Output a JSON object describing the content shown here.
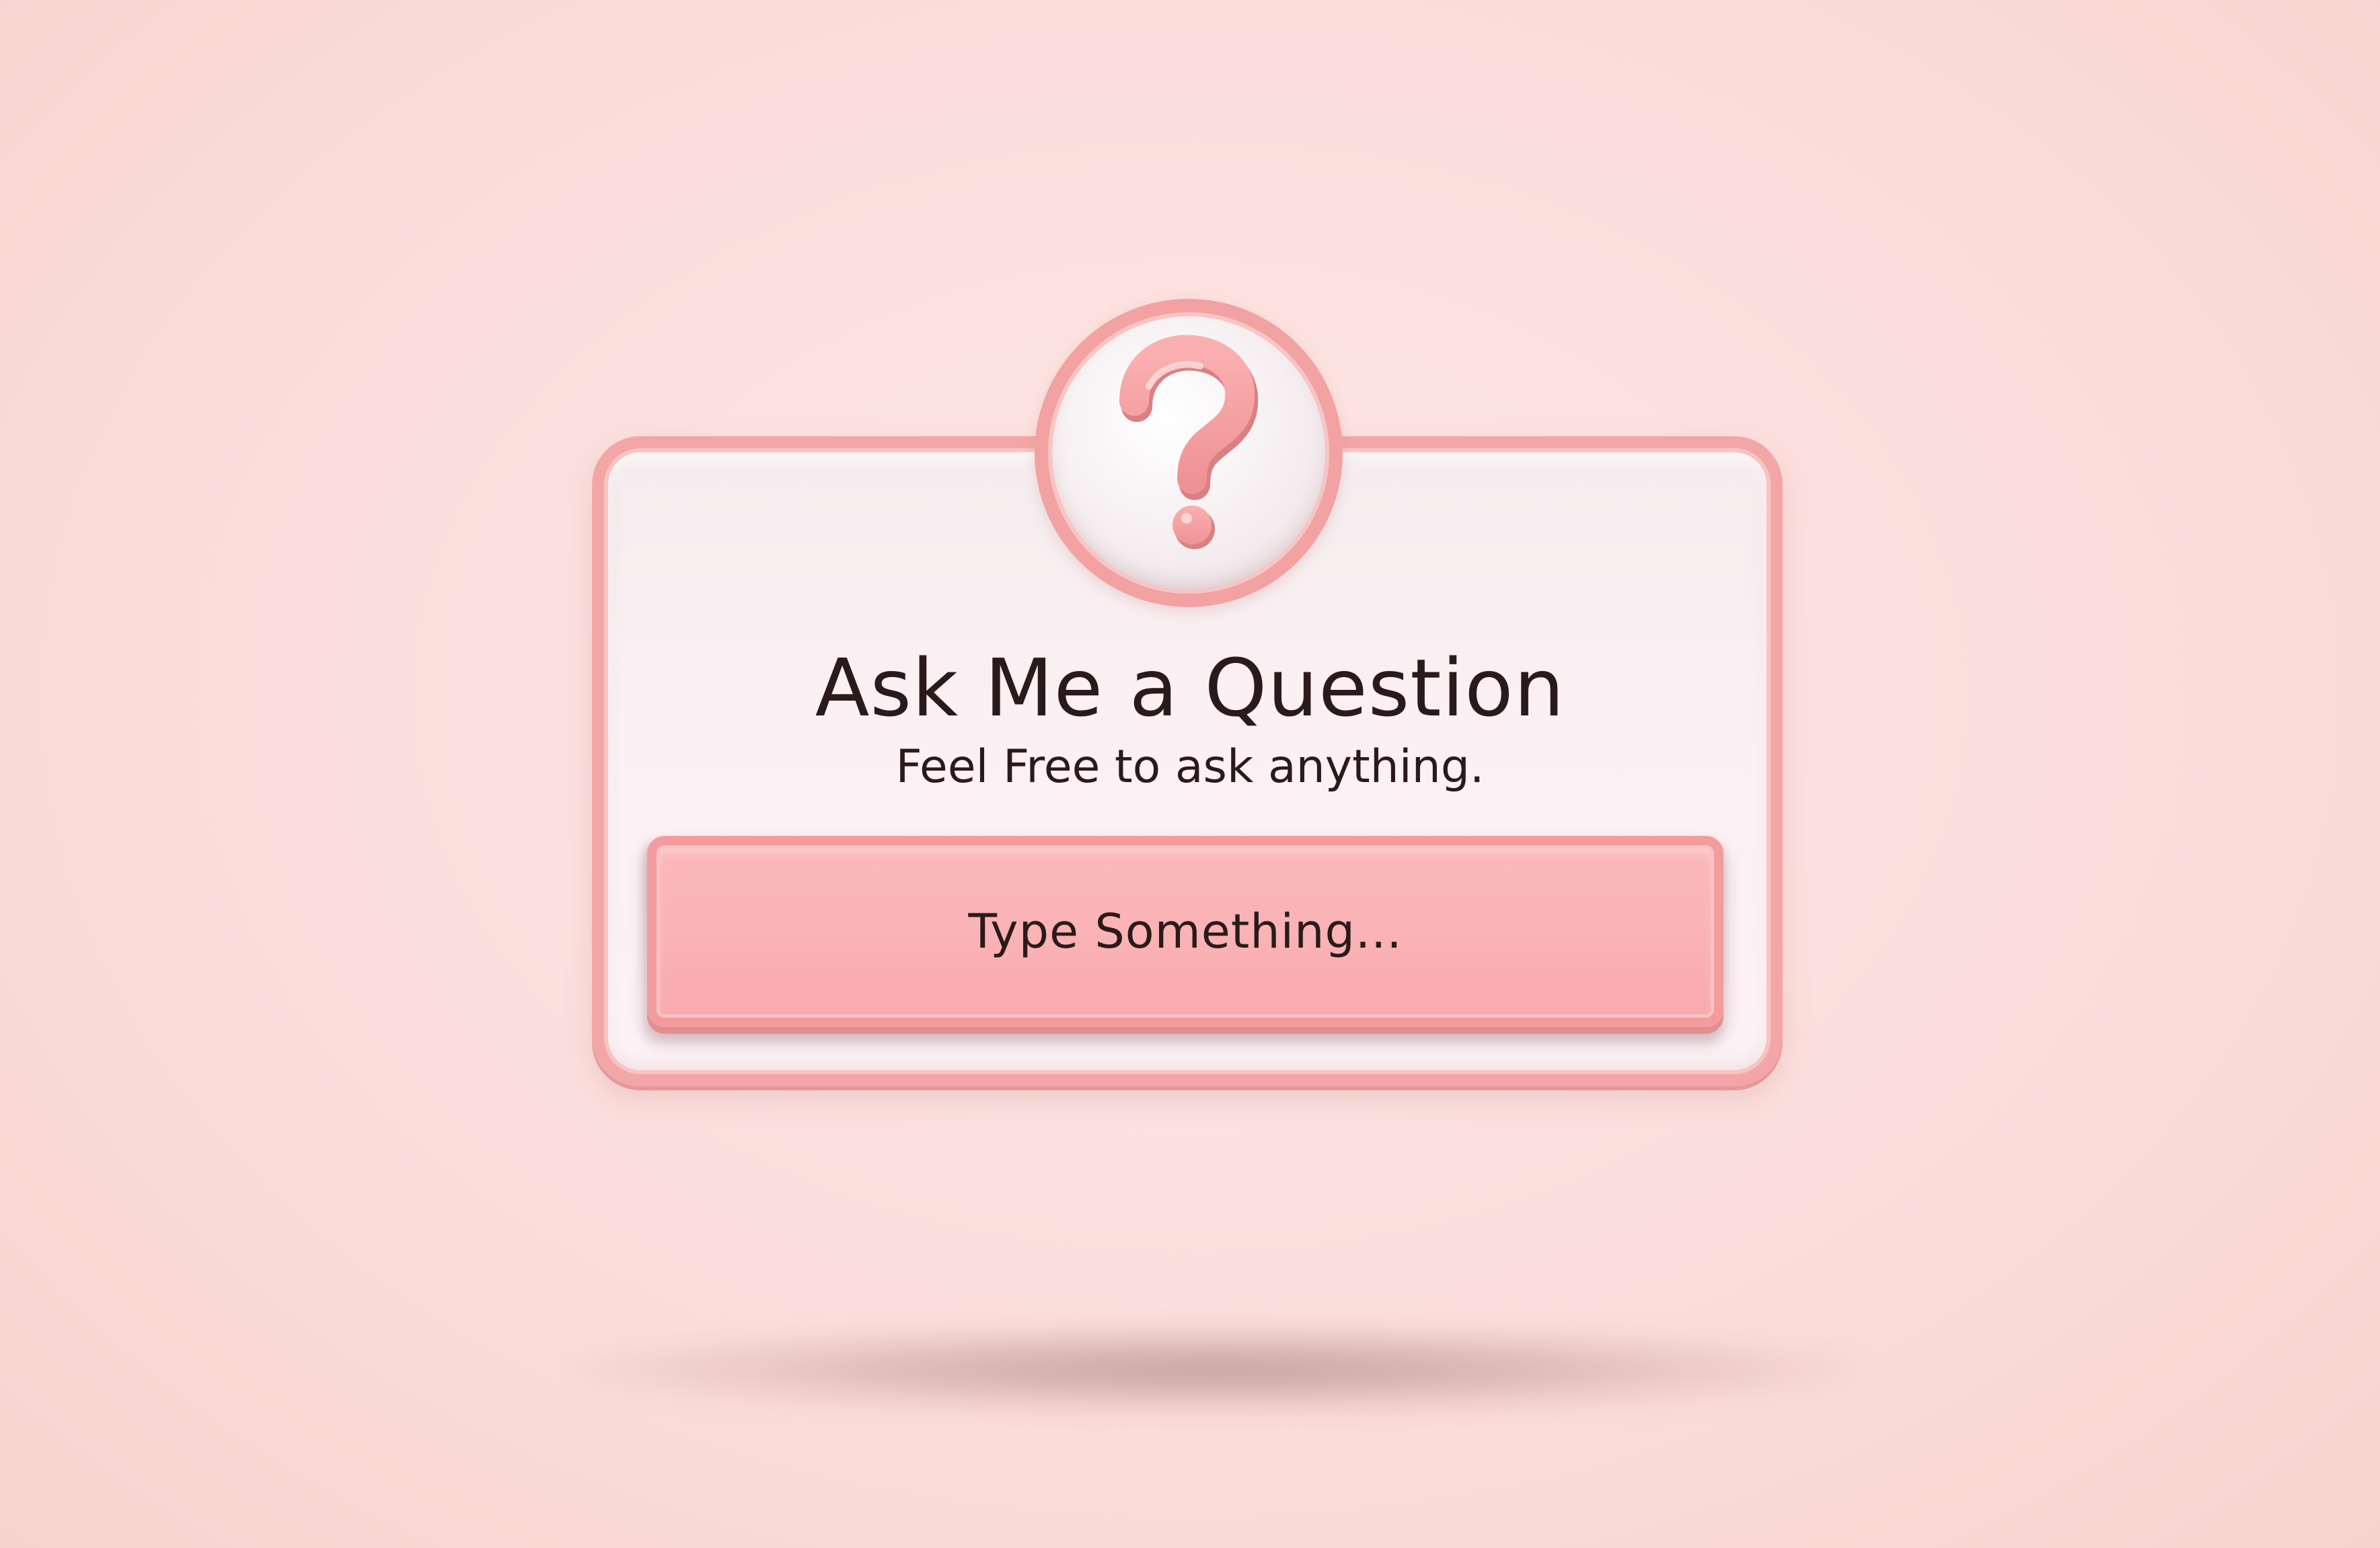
{
  "dialog": {
    "title": "Ask Me a Question",
    "subtitle": "Feel Free to ask anything.",
    "icon": "question-mark-icon"
  },
  "input": {
    "placeholder": "Type Something..."
  },
  "colors": {
    "background": "#fbdedb",
    "accent": "#f2a7a6",
    "input_fill": "#fab3b6",
    "card_fill": "#fbf0f3",
    "text": "#2b1a1c"
  }
}
